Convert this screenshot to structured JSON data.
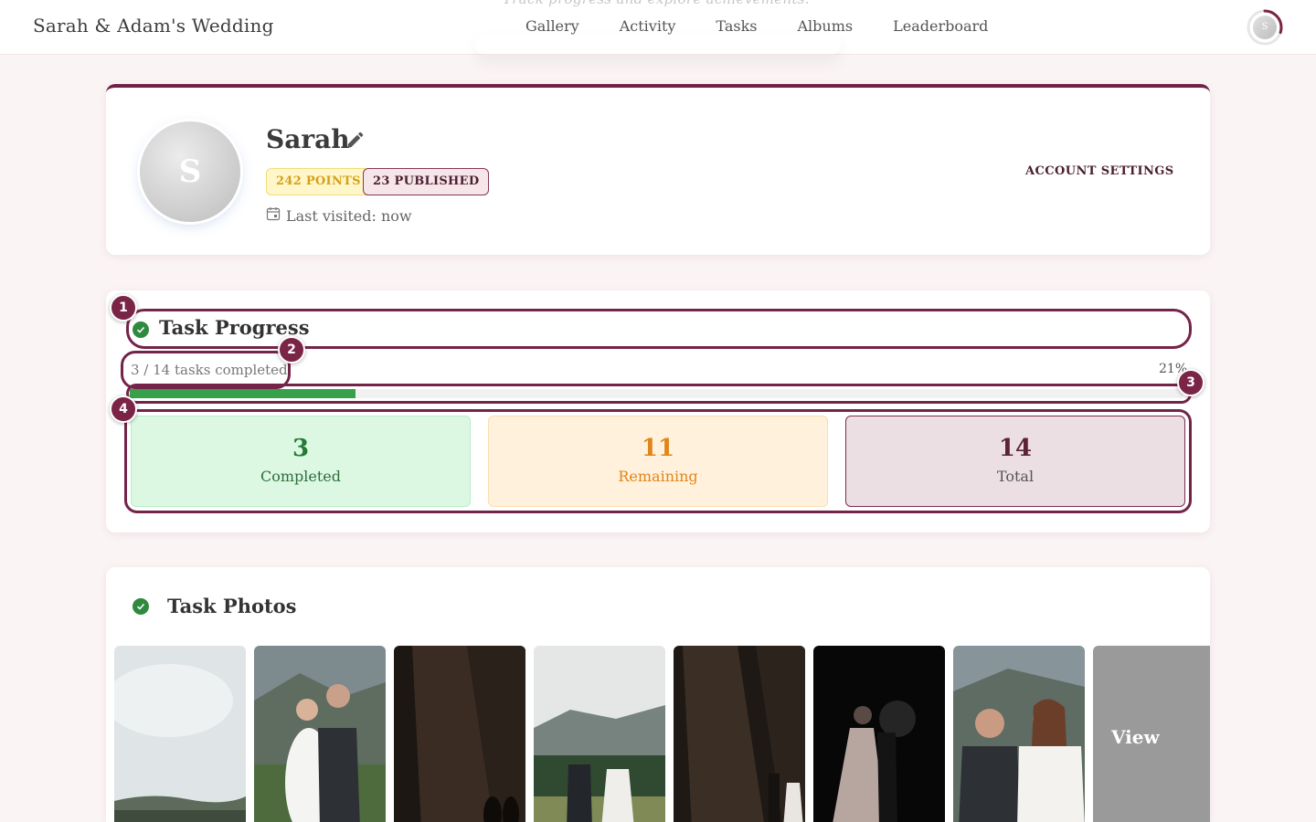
{
  "header": {
    "brand": "Sarah & Adam's Wedding",
    "ghost_text": "Track progress and explore achievements.",
    "nav": [
      "Gallery",
      "Activity",
      "Tasks",
      "Albums",
      "Leaderboard"
    ],
    "avatar_initial": "S",
    "avatar_progress": 0.3
  },
  "profile": {
    "initial": "S",
    "name": "Sarah",
    "points_badge": "242 POINTS",
    "published_badge": "23 PUBLISHED",
    "last_visited": "Last visited: now",
    "account_settings": "ACCOUNT SETTINGS"
  },
  "task_progress": {
    "title": "Task Progress",
    "tasks_completed_text": "3 / 14 tasks completed",
    "percent_text": "21%",
    "progress_fraction": 0.214,
    "stats": {
      "completed": {
        "value": "3",
        "label": "Completed"
      },
      "remaining": {
        "value": "11",
        "label": "Remaining"
      },
      "total": {
        "value": "14",
        "label": "Total"
      }
    },
    "markers": [
      "1",
      "2",
      "3",
      "4"
    ]
  },
  "task_photos": {
    "title": "Task Photos",
    "view_more": "View More"
  },
  "colors": {
    "accent": "#742448",
    "success": "#2e8a3e",
    "warning": "#e0851a"
  }
}
